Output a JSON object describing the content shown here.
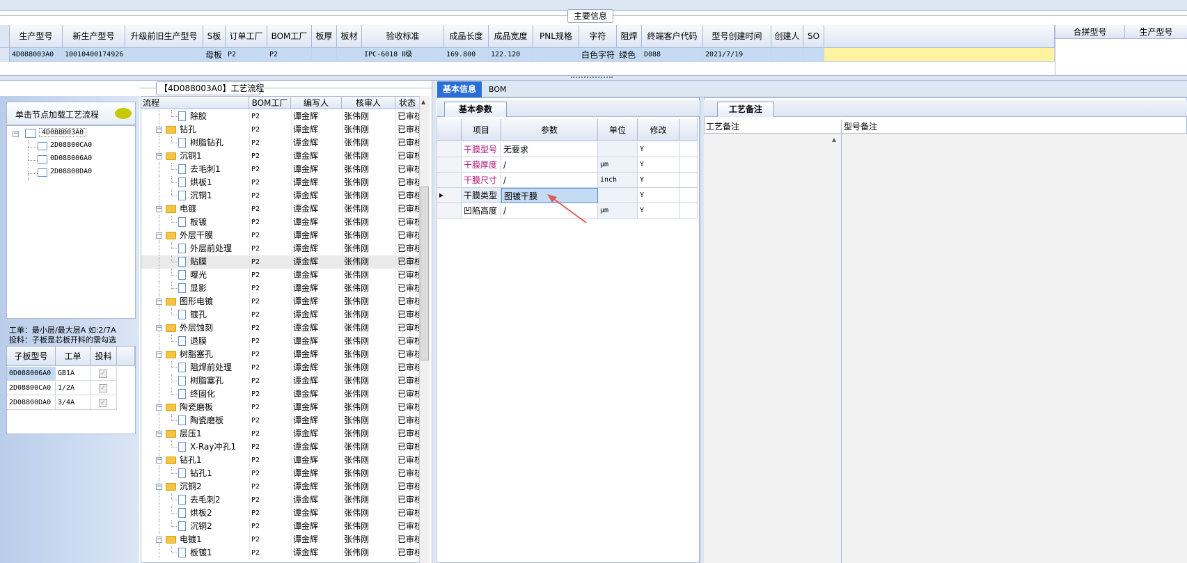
{
  "top": {
    "section_title": "主要信息",
    "columns": [
      "生产型号",
      "新生产型号",
      "升级前旧生产型号",
      "S板",
      "订单工厂",
      "BOM工厂",
      "板厚",
      "板材",
      "验收标准",
      "成品长度",
      "成品宽度",
      "PNL规格",
      "字符",
      "阻焊",
      "终端客户代码",
      "型号创建时间",
      "创建人",
      "SO"
    ],
    "row": [
      "4D088003A0",
      "10010400174926",
      "",
      "母板",
      "P2",
      "P2",
      "",
      "",
      "IPC-6018 Ⅱ级",
      "169.800",
      "122.120",
      "",
      "白色字符",
      "绿色",
      "D088",
      "2021/7/19",
      "",
      ""
    ],
    "right_columns": [
      "合拼型号",
      "生产型号"
    ]
  },
  "left": {
    "load_button": "单击节点加载工艺流程",
    "tree": {
      "root": "4D088003A0",
      "children": [
        "2D08800CA0",
        "0D088006A0",
        "2D08800DA0"
      ]
    },
    "hint1": "工单：最小层/最大层A 如:2/7A",
    "hint2": "投料：子板是芯板开料的需勾选",
    "sub_columns": [
      "子板型号",
      "工单",
      "投料"
    ],
    "sub_rows": [
      {
        "model": "0D088006A0",
        "order": "GB1A"
      },
      {
        "model": "2D08800CA0",
        "order": "1/2A"
      },
      {
        "model": "2D08800DA0",
        "order": "3/4A"
      }
    ]
  },
  "process": {
    "title": "【4D088003A0】工艺流程",
    "columns": [
      "流程",
      "BOM工厂",
      "编写人",
      "核审人",
      "状态"
    ],
    "rows": [
      {
        "name": "除胶",
        "type": "doc",
        "level": 2,
        "f": "P2",
        "w": "谭金辉",
        "r": "张伟刚",
        "s": "已审核"
      },
      {
        "name": "钻孔",
        "type": "folder",
        "level": 1,
        "f": "P2",
        "w": "谭金辉",
        "r": "张伟刚",
        "s": "已审核"
      },
      {
        "name": "树脂钻孔",
        "type": "doc",
        "level": 2,
        "f": "P2",
        "w": "谭金辉",
        "r": "张伟刚",
        "s": "已审核"
      },
      {
        "name": "沉铜1",
        "type": "folder",
        "level": 1,
        "f": "P2",
        "w": "谭金辉",
        "r": "张伟刚",
        "s": "已审核"
      },
      {
        "name": "去毛刺1",
        "type": "doc",
        "level": 2,
        "f": "P2",
        "w": "谭金辉",
        "r": "张伟刚",
        "s": "已审核"
      },
      {
        "name": "烘板1",
        "type": "doc",
        "level": 2,
        "f": "P2",
        "w": "谭金辉",
        "r": "张伟刚",
        "s": "已审核"
      },
      {
        "name": "沉铜1",
        "type": "doc",
        "level": 2,
        "f": "P2",
        "w": "谭金辉",
        "r": "张伟刚",
        "s": "已审核"
      },
      {
        "name": "电镀",
        "type": "folder",
        "level": 1,
        "f": "P2",
        "w": "谭金辉",
        "r": "张伟刚",
        "s": "已审核"
      },
      {
        "name": "板镀",
        "type": "doc",
        "level": 2,
        "f": "P2",
        "w": "谭金辉",
        "r": "张伟刚",
        "s": "已审核"
      },
      {
        "name": "外层干膜",
        "type": "folder",
        "level": 1,
        "f": "P2",
        "w": "谭金辉",
        "r": "张伟刚",
        "s": "已审核"
      },
      {
        "name": "外层前处理",
        "type": "doc",
        "level": 2,
        "f": "P2",
        "w": "谭金辉",
        "r": "张伟刚",
        "s": "已审核"
      },
      {
        "name": "贴膜",
        "type": "doc",
        "level": 2,
        "f": "P2",
        "w": "谭金辉",
        "r": "张伟刚",
        "s": "已审核",
        "sel": true
      },
      {
        "name": "曝光",
        "type": "doc",
        "level": 2,
        "f": "P2",
        "w": "谭金辉",
        "r": "张伟刚",
        "s": "已审核"
      },
      {
        "name": "显影",
        "type": "doc",
        "level": 2,
        "f": "P2",
        "w": "谭金辉",
        "r": "张伟刚",
        "s": "已审核"
      },
      {
        "name": "图形电镀",
        "type": "folder",
        "level": 1,
        "f": "P2",
        "w": "谭金辉",
        "r": "张伟刚",
        "s": "已审核"
      },
      {
        "name": "镀孔",
        "type": "doc",
        "level": 2,
        "f": "P2",
        "w": "谭金辉",
        "r": "张伟刚",
        "s": "已审核"
      },
      {
        "name": "外层蚀刻",
        "type": "folder",
        "level": 1,
        "f": "P2",
        "w": "谭金辉",
        "r": "张伟刚",
        "s": "已审核"
      },
      {
        "name": "退膜",
        "type": "doc",
        "level": 2,
        "f": "P2",
        "w": "谭金辉",
        "r": "张伟刚",
        "s": "已审核"
      },
      {
        "name": "树脂塞孔",
        "type": "folder",
        "level": 1,
        "f": "P2",
        "w": "谭金辉",
        "r": "张伟刚",
        "s": "已审核"
      },
      {
        "name": "阻焊前处理",
        "type": "doc",
        "level": 2,
        "f": "P2",
        "w": "谭金辉",
        "r": "张伟刚",
        "s": "已审核"
      },
      {
        "name": "树脂塞孔",
        "type": "doc",
        "level": 2,
        "f": "P2",
        "w": "谭金辉",
        "r": "张伟刚",
        "s": "已审核"
      },
      {
        "name": "终固化",
        "type": "doc",
        "level": 2,
        "f": "P2",
        "w": "谭金辉",
        "r": "张伟刚",
        "s": "已审核"
      },
      {
        "name": "陶瓷磨板",
        "type": "folder",
        "level": 1,
        "f": "P2",
        "w": "谭金辉",
        "r": "张伟刚",
        "s": "已审核"
      },
      {
        "name": "陶瓷磨板",
        "type": "doc",
        "level": 2,
        "f": "P2",
        "w": "谭金辉",
        "r": "张伟刚",
        "s": "已审核"
      },
      {
        "name": "层压1",
        "type": "folder",
        "level": 1,
        "f": "P2",
        "w": "谭金辉",
        "r": "张伟刚",
        "s": "已审核"
      },
      {
        "name": "X-Ray冲孔1",
        "type": "doc",
        "level": 2,
        "f": "P2",
        "w": "谭金辉",
        "r": "张伟刚",
        "s": "已审核"
      },
      {
        "name": "钻孔1",
        "type": "folder",
        "level": 1,
        "f": "P2",
        "w": "谭金辉",
        "r": "张伟刚",
        "s": "已审核"
      },
      {
        "name": "钻孔1",
        "type": "doc",
        "level": 2,
        "f": "P2",
        "w": "谭金辉",
        "r": "张伟刚",
        "s": "已审核"
      },
      {
        "name": "沉铜2",
        "type": "folder",
        "level": 1,
        "f": "P2",
        "w": "谭金辉",
        "r": "张伟刚",
        "s": "已审核"
      },
      {
        "name": "去毛刺2",
        "type": "doc",
        "level": 2,
        "f": "P2",
        "w": "谭金辉",
        "r": "张伟刚",
        "s": "已审核"
      },
      {
        "name": "烘板2",
        "type": "doc",
        "level": 2,
        "f": "P2",
        "w": "谭金辉",
        "r": "张伟刚",
        "s": "已审核"
      },
      {
        "name": "沉铜2",
        "type": "doc",
        "level": 2,
        "f": "P2",
        "w": "谭金辉",
        "r": "张伟刚",
        "s": "已审核"
      },
      {
        "name": "电镀1",
        "type": "folder",
        "level": 1,
        "f": "P2",
        "w": "谭金辉",
        "r": "张伟刚",
        "s": "已审核"
      },
      {
        "name": "板镀1",
        "type": "doc",
        "level": 2,
        "f": "P2",
        "w": "谭金辉",
        "r": "张伟刚",
        "s": "已审核"
      }
    ]
  },
  "detail": {
    "tabs": [
      "基本信息",
      "BOM"
    ],
    "subtab": "基本参数",
    "columns": [
      "项目",
      "参数",
      "单位",
      "修改"
    ],
    "rows": [
      {
        "item": "干膜型号",
        "param": "无要求",
        "unit": "",
        "mod": "Y",
        "pink": true
      },
      {
        "item": "干膜厚度",
        "param": "/",
        "unit": "μm",
        "mod": "Y",
        "pink": true
      },
      {
        "item": "干膜尺寸",
        "param": "/",
        "unit": "inch",
        "mod": "Y",
        "pink": true
      },
      {
        "item": "干膜类型",
        "param": "图镀干膜",
        "unit": "",
        "mod": "Y",
        "pink": false,
        "current": true
      },
      {
        "item": "凹陷高度",
        "param": "/",
        "unit": "μm",
        "mod": "Y",
        "pink": false
      }
    ]
  },
  "remarks": {
    "tab": "工艺备注",
    "col1": "工艺备注",
    "col2": "型号备注"
  },
  "colors": {
    "accent": "#1f5fbf",
    "pink": "#b0127a",
    "header_bg": "#dde6f3",
    "selected_row": "#c5dbf4",
    "yellow": "#fff3a0"
  }
}
